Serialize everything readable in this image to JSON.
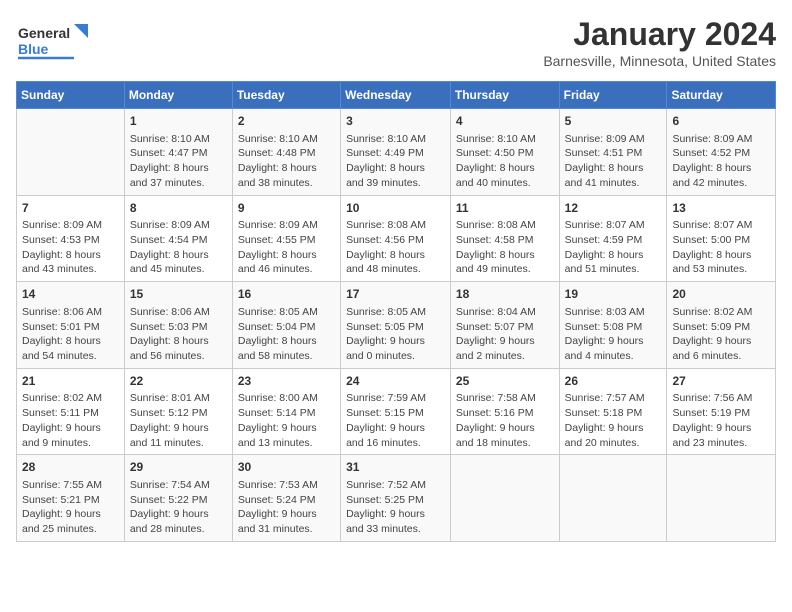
{
  "header": {
    "logo_general": "General",
    "logo_blue": "Blue",
    "month": "January 2024",
    "location": "Barnesville, Minnesota, United States"
  },
  "days_of_week": [
    "Sunday",
    "Monday",
    "Tuesday",
    "Wednesday",
    "Thursday",
    "Friday",
    "Saturday"
  ],
  "weeks": [
    [
      {
        "day": "",
        "info": ""
      },
      {
        "day": "1",
        "info": "Sunrise: 8:10 AM\nSunset: 4:47 PM\nDaylight: 8 hours\nand 37 minutes."
      },
      {
        "day": "2",
        "info": "Sunrise: 8:10 AM\nSunset: 4:48 PM\nDaylight: 8 hours\nand 38 minutes."
      },
      {
        "day": "3",
        "info": "Sunrise: 8:10 AM\nSunset: 4:49 PM\nDaylight: 8 hours\nand 39 minutes."
      },
      {
        "day": "4",
        "info": "Sunrise: 8:10 AM\nSunset: 4:50 PM\nDaylight: 8 hours\nand 40 minutes."
      },
      {
        "day": "5",
        "info": "Sunrise: 8:09 AM\nSunset: 4:51 PM\nDaylight: 8 hours\nand 41 minutes."
      },
      {
        "day": "6",
        "info": "Sunrise: 8:09 AM\nSunset: 4:52 PM\nDaylight: 8 hours\nand 42 minutes."
      }
    ],
    [
      {
        "day": "7",
        "info": "Sunrise: 8:09 AM\nSunset: 4:53 PM\nDaylight: 8 hours\nand 43 minutes."
      },
      {
        "day": "8",
        "info": "Sunrise: 8:09 AM\nSunset: 4:54 PM\nDaylight: 8 hours\nand 45 minutes."
      },
      {
        "day": "9",
        "info": "Sunrise: 8:09 AM\nSunset: 4:55 PM\nDaylight: 8 hours\nand 46 minutes."
      },
      {
        "day": "10",
        "info": "Sunrise: 8:08 AM\nSunset: 4:56 PM\nDaylight: 8 hours\nand 48 minutes."
      },
      {
        "day": "11",
        "info": "Sunrise: 8:08 AM\nSunset: 4:58 PM\nDaylight: 8 hours\nand 49 minutes."
      },
      {
        "day": "12",
        "info": "Sunrise: 8:07 AM\nSunset: 4:59 PM\nDaylight: 8 hours\nand 51 minutes."
      },
      {
        "day": "13",
        "info": "Sunrise: 8:07 AM\nSunset: 5:00 PM\nDaylight: 8 hours\nand 53 minutes."
      }
    ],
    [
      {
        "day": "14",
        "info": "Sunrise: 8:06 AM\nSunset: 5:01 PM\nDaylight: 8 hours\nand 54 minutes."
      },
      {
        "day": "15",
        "info": "Sunrise: 8:06 AM\nSunset: 5:03 PM\nDaylight: 8 hours\nand 56 minutes."
      },
      {
        "day": "16",
        "info": "Sunrise: 8:05 AM\nSunset: 5:04 PM\nDaylight: 8 hours\nand 58 minutes."
      },
      {
        "day": "17",
        "info": "Sunrise: 8:05 AM\nSunset: 5:05 PM\nDaylight: 9 hours\nand 0 minutes."
      },
      {
        "day": "18",
        "info": "Sunrise: 8:04 AM\nSunset: 5:07 PM\nDaylight: 9 hours\nand 2 minutes."
      },
      {
        "day": "19",
        "info": "Sunrise: 8:03 AM\nSunset: 5:08 PM\nDaylight: 9 hours\nand 4 minutes."
      },
      {
        "day": "20",
        "info": "Sunrise: 8:02 AM\nSunset: 5:09 PM\nDaylight: 9 hours\nand 6 minutes."
      }
    ],
    [
      {
        "day": "21",
        "info": "Sunrise: 8:02 AM\nSunset: 5:11 PM\nDaylight: 9 hours\nand 9 minutes."
      },
      {
        "day": "22",
        "info": "Sunrise: 8:01 AM\nSunset: 5:12 PM\nDaylight: 9 hours\nand 11 minutes."
      },
      {
        "day": "23",
        "info": "Sunrise: 8:00 AM\nSunset: 5:14 PM\nDaylight: 9 hours\nand 13 minutes."
      },
      {
        "day": "24",
        "info": "Sunrise: 7:59 AM\nSunset: 5:15 PM\nDaylight: 9 hours\nand 16 minutes."
      },
      {
        "day": "25",
        "info": "Sunrise: 7:58 AM\nSunset: 5:16 PM\nDaylight: 9 hours\nand 18 minutes."
      },
      {
        "day": "26",
        "info": "Sunrise: 7:57 AM\nSunset: 5:18 PM\nDaylight: 9 hours\nand 20 minutes."
      },
      {
        "day": "27",
        "info": "Sunrise: 7:56 AM\nSunset: 5:19 PM\nDaylight: 9 hours\nand 23 minutes."
      }
    ],
    [
      {
        "day": "28",
        "info": "Sunrise: 7:55 AM\nSunset: 5:21 PM\nDaylight: 9 hours\nand 25 minutes."
      },
      {
        "day": "29",
        "info": "Sunrise: 7:54 AM\nSunset: 5:22 PM\nDaylight: 9 hours\nand 28 minutes."
      },
      {
        "day": "30",
        "info": "Sunrise: 7:53 AM\nSunset: 5:24 PM\nDaylight: 9 hours\nand 31 minutes."
      },
      {
        "day": "31",
        "info": "Sunrise: 7:52 AM\nSunset: 5:25 PM\nDaylight: 9 hours\nand 33 minutes."
      },
      {
        "day": "",
        "info": ""
      },
      {
        "day": "",
        "info": ""
      },
      {
        "day": "",
        "info": ""
      }
    ]
  ]
}
